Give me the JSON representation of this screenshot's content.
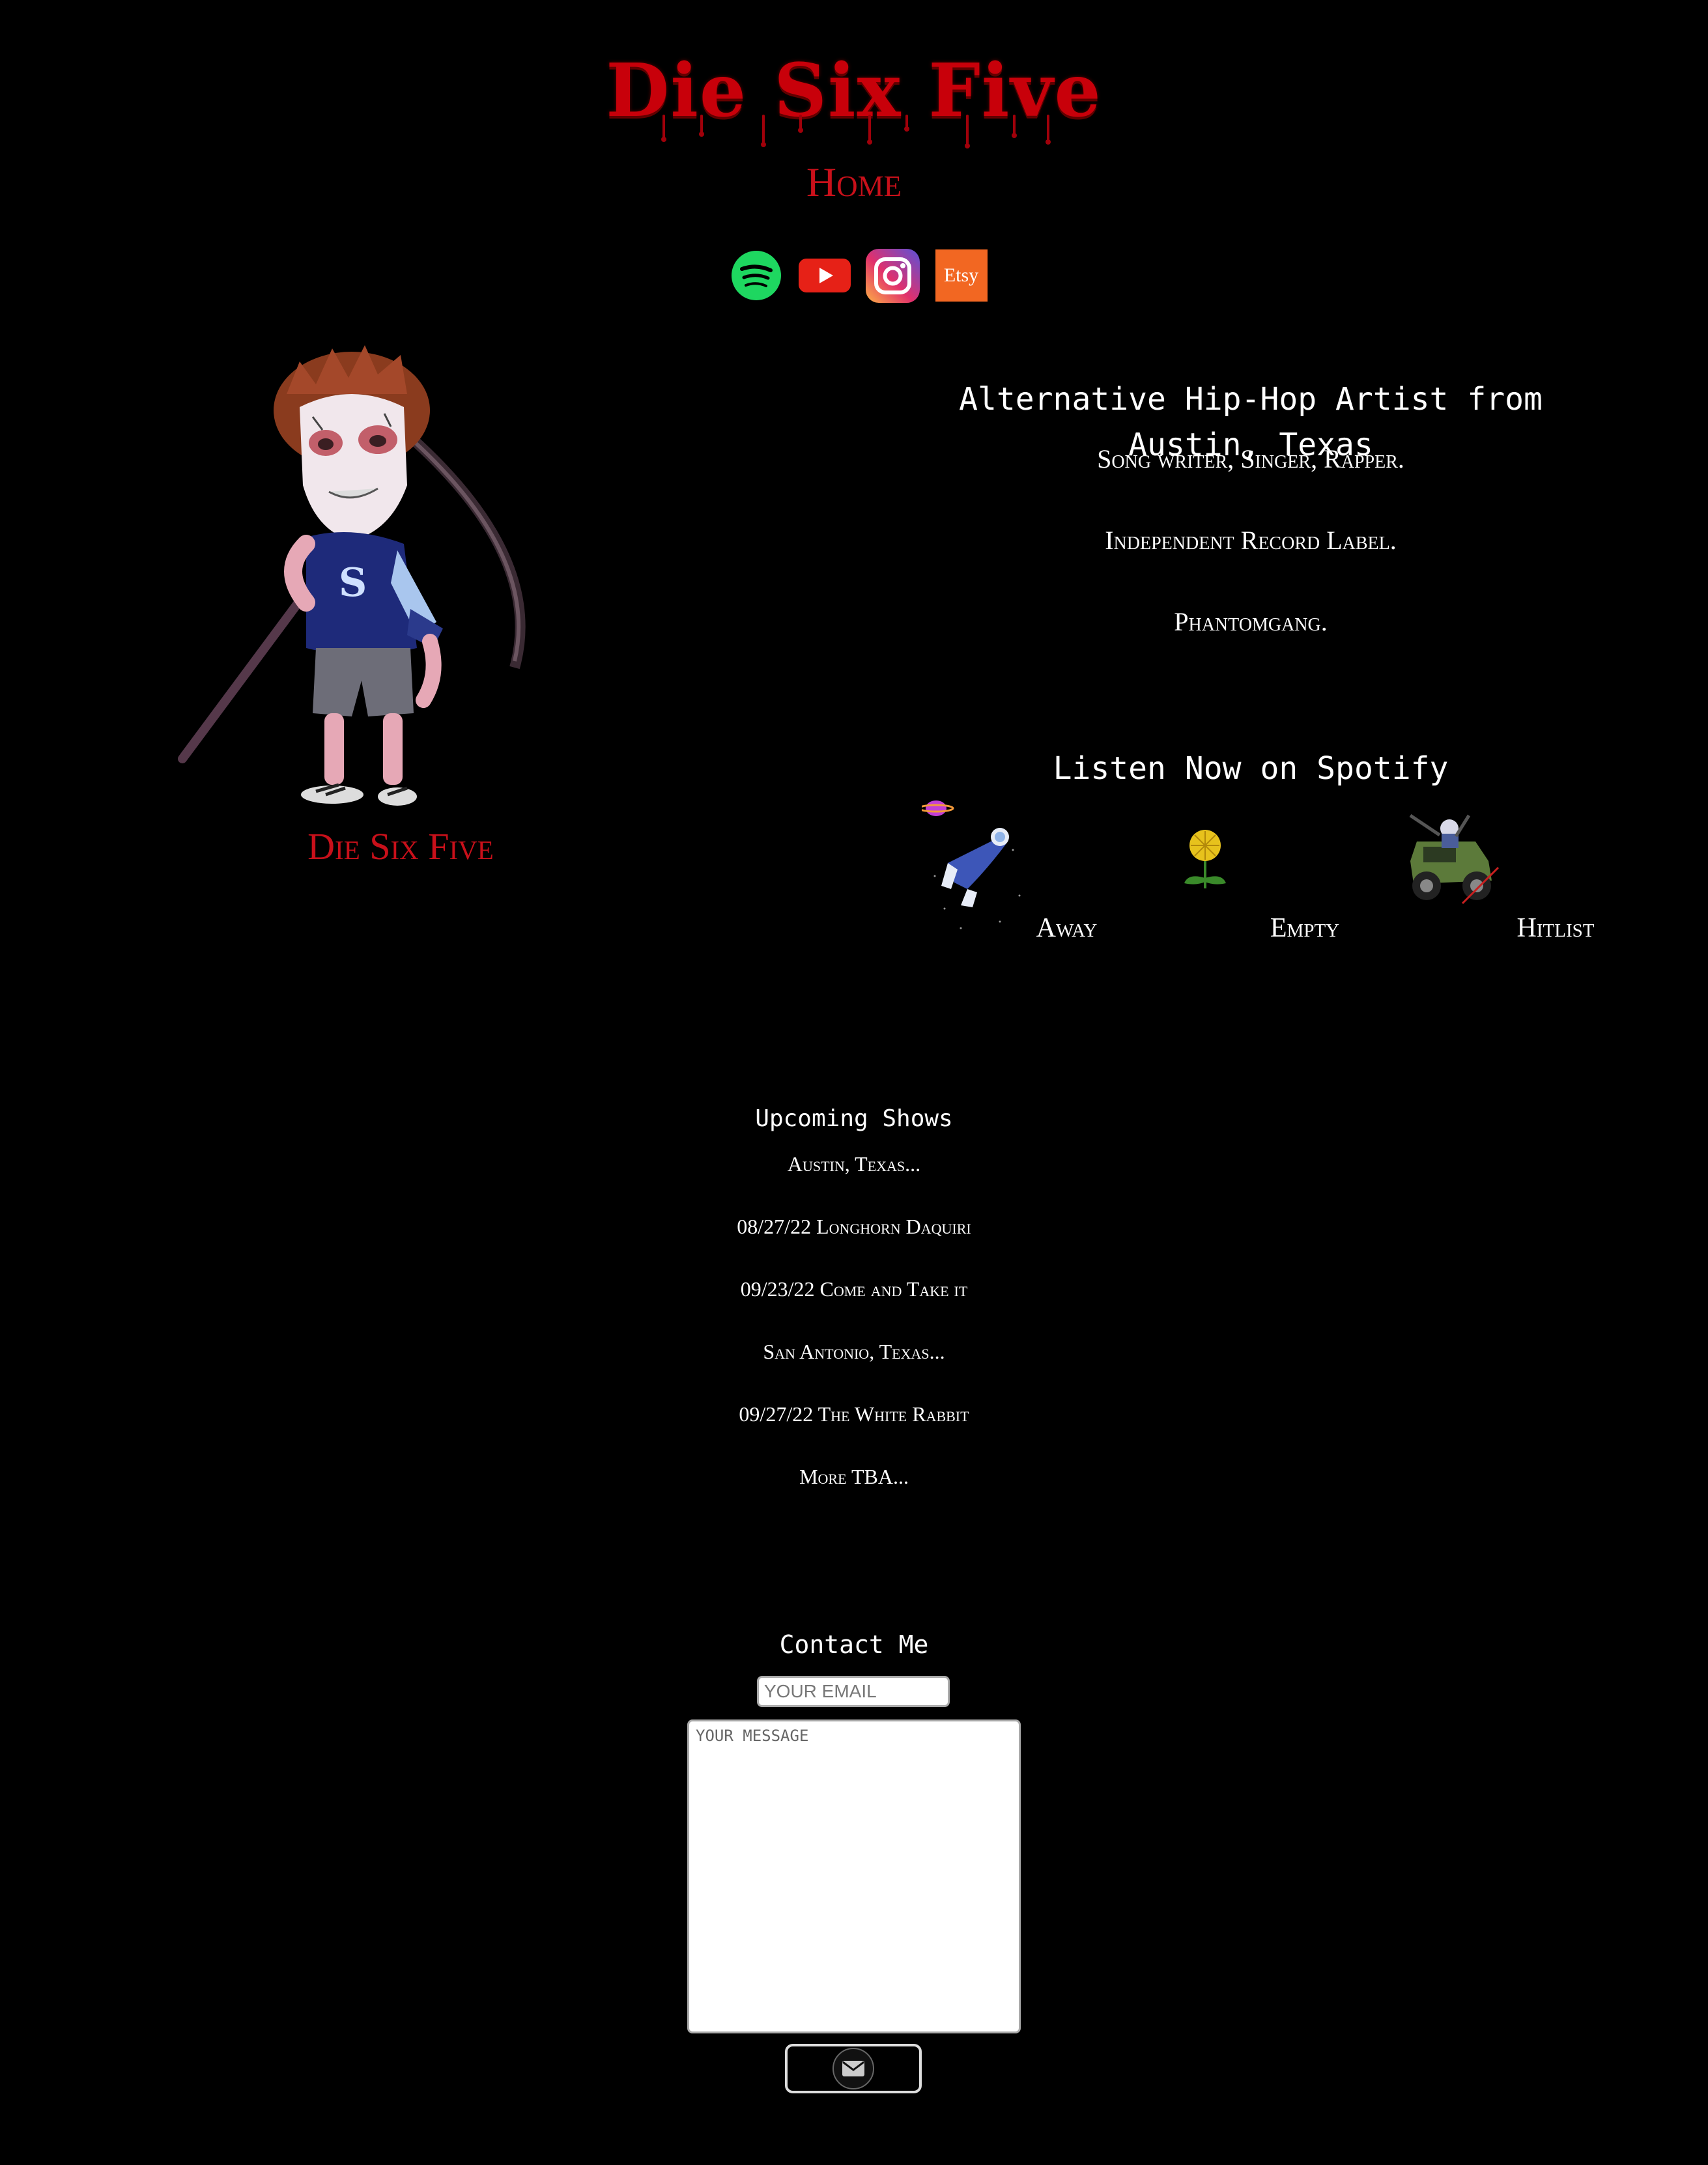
{
  "header": {
    "title": "Die Six Five",
    "nav_home": "Home"
  },
  "social": [
    {
      "name": "spotify-icon",
      "label": "Spotify"
    },
    {
      "name": "youtube-icon",
      "label": "YouTube"
    },
    {
      "name": "instagram-icon",
      "label": "Instagram"
    },
    {
      "name": "etsy-icon",
      "label": "Etsy"
    }
  ],
  "colors": {
    "background": "#000000",
    "accent_red": "#c8000a",
    "text": "#ffffff",
    "spotify_green": "#1ed760",
    "youtube_red": "#e62117",
    "etsy_orange": "#f26722"
  },
  "hero": {
    "caption": "Die Six Five"
  },
  "about": {
    "headline": "Alternative Hip-Hop Artist from Austin, Texas",
    "lines": [
      "Song writer, Singer, Rapper.",
      "Independent Record Label.",
      "Phantomgang."
    ]
  },
  "music": {
    "heading": "Listen Now on Spotify",
    "songs": [
      {
        "title": "Away",
        "art": "astronaut-art"
      },
      {
        "title": "Empty",
        "art": "dandelion-art"
      },
      {
        "title": "Hitlist",
        "art": "jeep-art"
      }
    ]
  },
  "shows": {
    "heading": "Upcoming Shows",
    "lines": [
      "Austin, Texas...",
      "08/27/22 Longhorn Daquiri",
      "09/23/22 Come and Take it",
      "San Antonio, Texas...",
      "09/27/22 The White Rabbit",
      "More TBA..."
    ]
  },
  "contact": {
    "heading": "Contact Me",
    "email_placeholder": "YOUR EMAIL",
    "message_placeholder": "YOUR MESSAGE",
    "send_icon": "envelope-icon"
  }
}
